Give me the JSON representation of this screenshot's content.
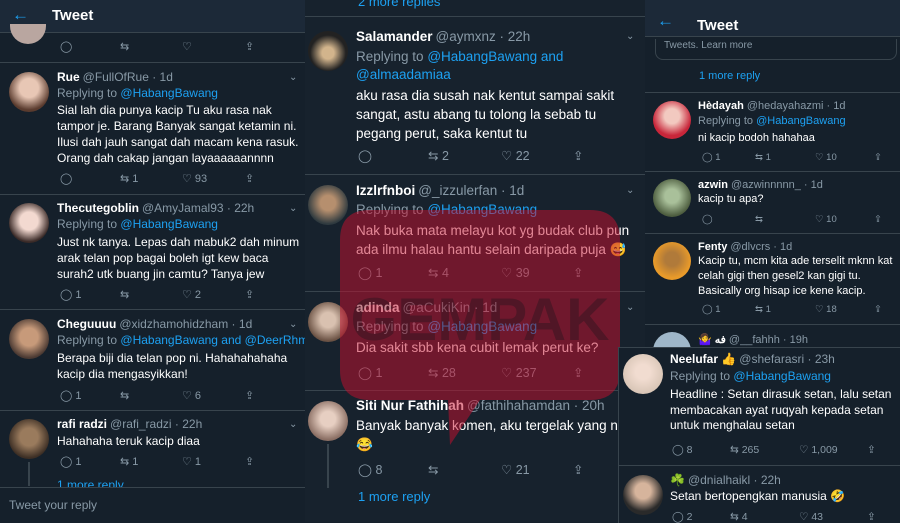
{
  "left": {
    "back_icon": "arrow-left-icon",
    "title": "Tweet",
    "tweets": [
      {
        "name": "Rue",
        "handle": "@FullOfRue · 1d",
        "replying": "Replying to",
        "mention": "@HabangBawang",
        "body": "Sial lah dia punya kacip Tu aku rasa nak tampor je. Barang Banyak sangat ketamin ni. Ilusi dah jauh sangat dah macam kena rasuk. Orang dah cakap jangan layaaaaaannnn",
        "rt": "1",
        "like": "93"
      },
      {
        "name": "Thecutegoblin",
        "handle": "@AmyJamal93 · 22h",
        "replying": "Replying to",
        "mention": "@HabangBawang",
        "body": "Just nk tanya. Lepas dah mabuk2 dah minum arak telan pop bagai boleh igt kew baca surah2 utk buang jin camtu? Tanya jew",
        "reply": "1",
        "like": "2"
      },
      {
        "name": "Cheguuuu",
        "handle": "@xidzhamohidzham · 1d",
        "replying": "Replying to",
        "mention": "@HabangBawang and @DeerRhm",
        "body": "Berapa biji dia telan pop ni. Hahahahahaha kacip dia mengasyikkan!",
        "reply": "1",
        "like": "6"
      },
      {
        "name": "rafi radzi",
        "handle": "@rafi_radzi · 22h",
        "body": "Hahahaha teruk kacip diaa",
        "reply": "1",
        "rt": "1",
        "like": "1",
        "more": "1 more reply"
      }
    ],
    "composer_placeholder": "Tweet your reply"
  },
  "middle": {
    "top_more": "2 more replies",
    "tweets": [
      {
        "name": "Salamander",
        "handle": "@aymxnz · 22h",
        "replying": "Replying to",
        "mention1": "@HabangBawang and",
        "mention2": "@almaadamiaa",
        "body": "aku rasa dia susah nak kentut sampai sakit sangat, astu abang tu tolong la sebab tu pegang perut, saka kentut tu",
        "rt": "2",
        "like": "22"
      },
      {
        "name": "Izzlrfnboi",
        "handle": "@_izzulerfan · 1d",
        "replying": "Replying to",
        "mention": "@HabangBawang",
        "body": "Nak buka mata melayu kot yg budak club pun ada ilmu halau hantu selain daripada puja 😅",
        "reply": "1",
        "rt": "4",
        "like": "39"
      },
      {
        "name": "adinda",
        "handle": "@aCukiKin · 1d",
        "replying": "Replying to",
        "mention": "@HabangBawang",
        "body": "Dia sakit sbb kena cubit lemak perut ke?",
        "reply": "1",
        "rt": "28",
        "like": "237"
      },
      {
        "name": "Siti Nur Fathihah",
        "handle": "@fathihahamdan · 20h",
        "body": "Banyak banyak komen, aku tergelak yang n 😂",
        "reply": "8",
        "like": "21",
        "more": "1 more reply"
      }
    ]
  },
  "right": {
    "title": "Tweet",
    "tweets_learn": "Tweets. Learn more",
    "more_reply": "1 more reply",
    "tweets": [
      {
        "name": "Hèdayah",
        "handle": "@hedayahazmi · 1d",
        "replying": "Replying to",
        "mention": "@HabangBawang",
        "body": "ni kacip bodoh hahahaa",
        "reply": "1",
        "rt": "1",
        "like": "10"
      },
      {
        "name": "azwin",
        "handle": "@azwinnnnn_ · 1d",
        "body": "kacip tu apa?",
        "like": "10"
      },
      {
        "name": "Fenty",
        "handle": "@dlvcrs · 1d",
        "body": "Kacip tu, mcm kita ade terselit mknn kat celah gigi then gesel2 kan gigi tu. Basically org hisap ice kene kacip.",
        "reply": "1",
        "rt": "1",
        "like": "18"
      },
      {
        "name": "🤷‍♀️ ﻓﻪ",
        "handle": "@__fahhh · 19h"
      }
    ]
  },
  "overlay": {
    "tweets": [
      {
        "name": "Neelufar 👍",
        "handle": "@shefarasri · 23h",
        "replying": "Replying to",
        "mention": "@HabangBawang",
        "body": "Headline : Setan dirasuk setan, lalu setan membacakan ayat ruqyah kepada setan untuk menghalau setan",
        "reply": "8",
        "rt": "265",
        "like": "1,009"
      },
      {
        "name": "☘️",
        "handle": "@dnialhaikl · 22h",
        "body": "Setan bertopengkan manusia 🤣",
        "reply": "2",
        "rt": "4",
        "like": "43"
      }
    ]
  },
  "watermark": "GEMPAK",
  "colors": {
    "bg": "#15202b",
    "accent": "#1da1f2",
    "muted": "#8899a6",
    "watermark": "#c8102e"
  }
}
